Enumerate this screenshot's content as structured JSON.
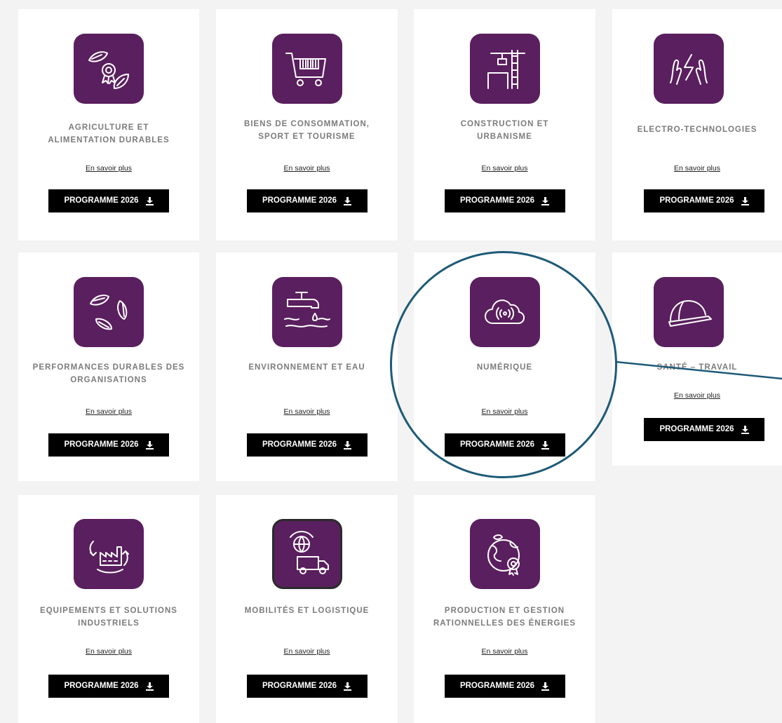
{
  "cards": [
    {
      "title": "AGRICULTURE ET\nALIMENTATION DURABLES",
      "more": "En savoir plus",
      "button": "PROGRAMME 2026",
      "icon": "leaf-award-icon"
    },
    {
      "title": "BIENS DE CONSOMMATION,\nSPORT ET TOURISME",
      "more": "En savoir plus",
      "button": "PROGRAMME 2026",
      "icon": "shopping-cart-icon"
    },
    {
      "title": "CONSTRUCTION ET\nURBANISME",
      "more": "En savoir plus",
      "button": "PROGRAMME 2026",
      "icon": "crane-icon"
    },
    {
      "title": "ELECTRO-TECHNOLOGIES",
      "more": "En savoir plus",
      "button": "PROGRAMME 2026",
      "icon": "hands-lightning-icon"
    },
    {
      "title": "PERFORMANCES DURABLES DES\nORGANISATIONS",
      "more": "En savoir plus",
      "button": "PROGRAMME 2026",
      "icon": "leaves-cycle-icon"
    },
    {
      "title": "ENVIRONNEMENT ET EAU",
      "more": "En savoir plus",
      "button": "PROGRAMME 2026",
      "icon": "water-tap-icon"
    },
    {
      "title": "NUMÉRIQUE",
      "more": "En savoir plus",
      "button": "PROGRAMME 2026",
      "icon": "cloud-signal-icon"
    },
    {
      "title": "SANTÉ – TRAVAIL",
      "more": "En savoir plus",
      "button": "PROGRAMME 2026",
      "icon": "hard-hat-icon"
    },
    {
      "title": "EQUIPEMENTS ET SOLUTIONS\nINDUSTRIELS",
      "more": "En savoir plus",
      "button": "PROGRAMME 2026",
      "icon": "factory-icon"
    },
    {
      "title": "MOBILITÉS ET LOGISTIQUE",
      "more": "En savoir plus",
      "button": "PROGRAMME 2026",
      "icon": "truck-globe-icon"
    },
    {
      "title": "PRODUCTION ET GESTION\nRATIONNELLES DES ÉNERGIES",
      "more": "En savoir plus",
      "button": "PROGRAMME 2026",
      "icon": "earth-award-icon"
    }
  ],
  "colors": {
    "icon_bg": "#5a1f5e",
    "highlight": "#1e5a78",
    "button_bg": "#000000"
  }
}
